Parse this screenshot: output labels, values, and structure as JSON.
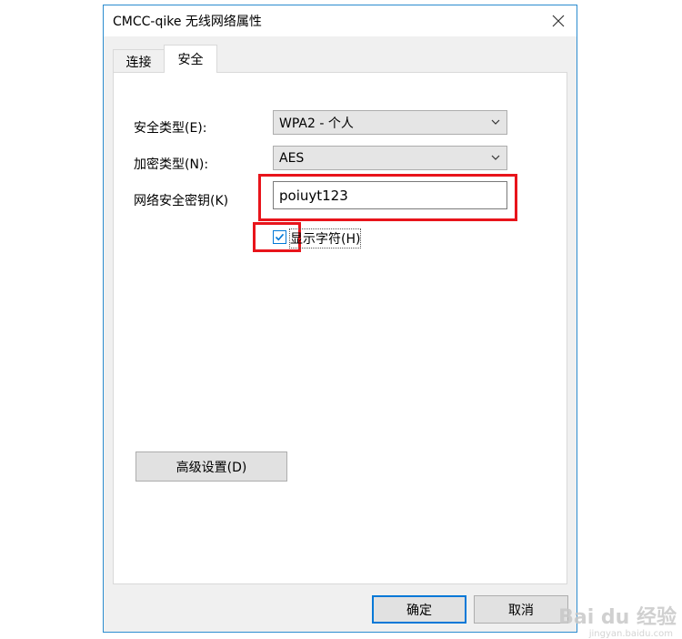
{
  "window": {
    "title": "CMCC-qike 无线网络属性",
    "close_icon": "close-icon"
  },
  "tabs": [
    {
      "label": "连接",
      "active": false
    },
    {
      "label": "安全",
      "active": true
    }
  ],
  "form": {
    "security_type_label": "安全类型(E):",
    "security_type_value": "WPA2 - 个人",
    "encryption_type_label": "加密类型(N):",
    "encryption_type_value": "AES",
    "network_key_label": "网络安全密钥(K)",
    "network_key_value": "poiuyt123",
    "show_chars_label": "显示字符(H)",
    "show_chars_checked": true,
    "highlight_color": "#e8141b"
  },
  "buttons": {
    "advanced_label": "高级设置(D)",
    "ok_label": "确定",
    "cancel_label": "取消"
  },
  "watermark": {
    "text": "Bai du 经验",
    "sub": "jingyan.baidu.com"
  }
}
